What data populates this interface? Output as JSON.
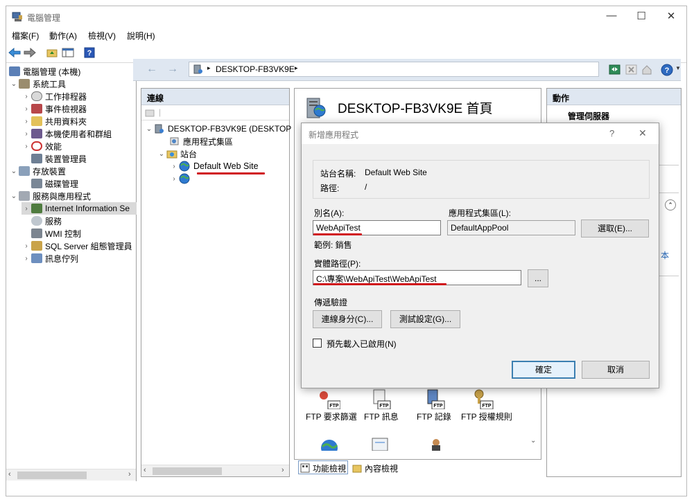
{
  "window": {
    "title": "電腦管理",
    "minimize": "—",
    "maximize": "☐",
    "close": "✕"
  },
  "menu": [
    "檔案(F)",
    "動作(A)",
    "檢視(V)",
    "說明(H)"
  ],
  "left_tree": [
    {
      "label": "電腦管理 (本機)",
      "icon": "computer-mgmt-icon"
    },
    {
      "label": "系統工具",
      "icon": "tools-icon",
      "expander": "⌄"
    },
    {
      "label": "工作排程器",
      "icon": "clock-icon",
      "expander": "›"
    },
    {
      "label": "事件檢視器",
      "icon": "event-viewer-icon",
      "expander": "›"
    },
    {
      "label": "共用資料夾",
      "icon": "shared-folder-icon",
      "expander": "›"
    },
    {
      "label": "本機使用者和群組",
      "icon": "users-icon",
      "expander": "›"
    },
    {
      "label": "效能",
      "icon": "performance-icon",
      "expander": "›"
    },
    {
      "label": "裝置管理員",
      "icon": "device-manager-icon"
    },
    {
      "label": "存放裝置",
      "icon": "storage-icon",
      "expander": "⌄"
    },
    {
      "label": "磁碟管理",
      "icon": "disk-icon"
    },
    {
      "label": "服務與應用程式",
      "icon": "services-apps-icon",
      "expander": "⌄"
    },
    {
      "label": "Internet Information Se",
      "icon": "iis-icon",
      "expander": "›"
    },
    {
      "label": "服務",
      "icon": "gear-icon"
    },
    {
      "label": "WMI 控制",
      "icon": "wmi-icon"
    },
    {
      "label": "SQL Server 組態管理員",
      "icon": "sql-icon",
      "expander": "›"
    },
    {
      "label": "訊息佇列",
      "icon": "queue-icon",
      "expander": "›"
    }
  ],
  "address": {
    "path": "DESKTOP-FB3VK9E",
    "sep1": "▸",
    "sep2": "▸"
  },
  "connections": {
    "header": "連線",
    "server": "DESKTOP-FB3VK9E (DESKTOP",
    "app_pools": "應用程式集區",
    "sites": "站台",
    "site": "Default Web Site"
  },
  "home": {
    "title": "DESKTOP-FB3VK9E 首頁"
  },
  "features": [
    {
      "label": "FTP 要求篩選",
      "badge": "FTP"
    },
    {
      "label": "FTP 訊息",
      "badge": "FTP"
    },
    {
      "label": "FTP 記錄",
      "badge": "FTP"
    },
    {
      "label": "FTP 授權規則",
      "badge": "FTP"
    }
  ],
  "bottom_tabs": {
    "features_view": "功能檢視",
    "content_view": "內容檢視"
  },
  "actions": {
    "header": "動作",
    "manage_server": "管理伺服器",
    "partial_link": "本"
  },
  "dialog": {
    "title": "新增應用程式",
    "help": "?",
    "close": "✕",
    "site_name_label": "站台名稱:",
    "site_name_value": "Default Web Site",
    "path_label": "路徑:",
    "path_value": "/",
    "alias_label": "別名(A):",
    "alias_value": "WebApiTest",
    "pool_label": "應用程式集區(L):",
    "pool_value": "DefaultAppPool",
    "select_button": "選取(E)...",
    "example": "範例: 銷售",
    "physical_path_label": "實體路徑(P):",
    "physical_path_value": "C:\\專案\\WebApiTest\\WebApiTest",
    "browse_button": "...",
    "pass_through_label": "傳遞驗證",
    "connect_as_button": "連線身分(C)...",
    "test_settings_button": "測試設定(G)...",
    "preload_label": "預先載入已啟用(N)",
    "preload_checked": false,
    "ok_button": "確定",
    "cancel_button": "取消"
  }
}
